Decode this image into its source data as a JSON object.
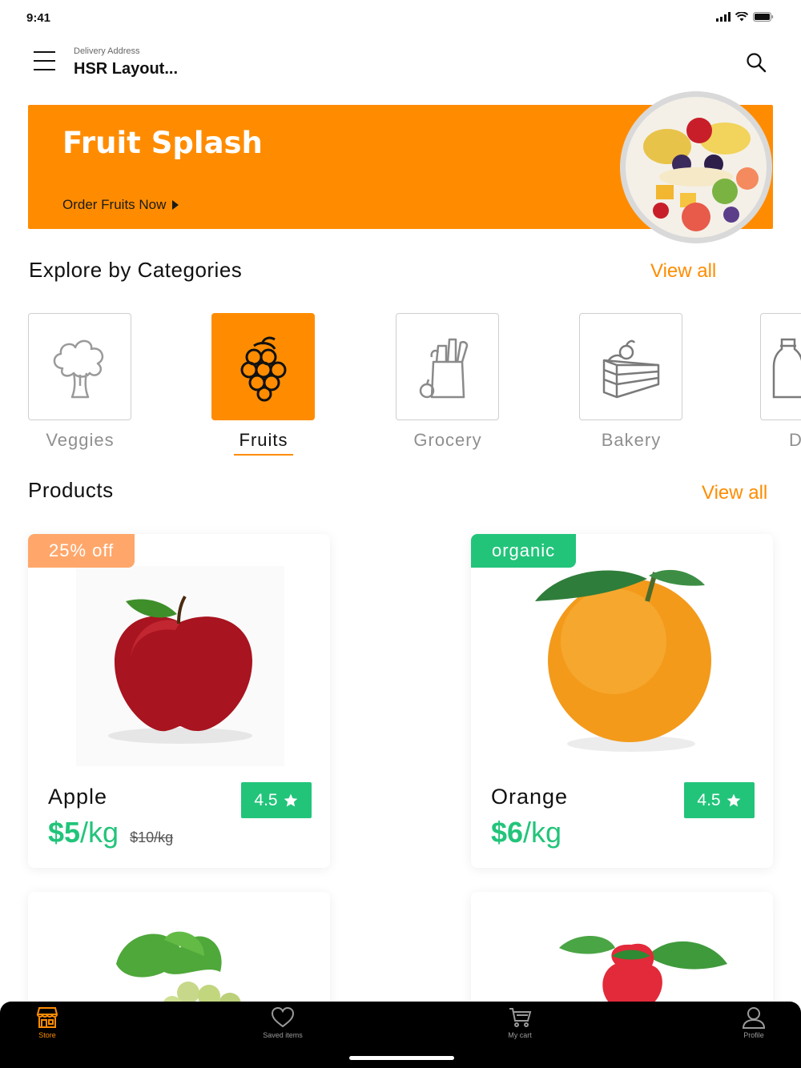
{
  "status_bar": {
    "time": "9:41"
  },
  "header": {
    "address_label": "Delivery Address",
    "address_value": "HSR Layout...",
    "menu_icon": "hamburger-menu-icon",
    "search_icon": "search-icon"
  },
  "banner": {
    "title": "Fruit Splash",
    "cta": "Order Fruits Now",
    "cta_icon": "play-triangle-icon",
    "image": "fruit-bowl-image",
    "color": "#ff8c00"
  },
  "categories": {
    "title": "Explore by Categories",
    "view_all": "View all",
    "items": [
      {
        "label": "Veggies",
        "icon": "broccoli-icon",
        "active": false
      },
      {
        "label": "Fruits",
        "icon": "grapes-icon",
        "active": true
      },
      {
        "label": "Grocery",
        "icon": "grocery-bag-icon",
        "active": false
      },
      {
        "label": "Bakery",
        "icon": "cake-icon",
        "active": false
      },
      {
        "label": "D",
        "icon": "milk-bottle-icon",
        "active": false
      }
    ]
  },
  "products": {
    "title": "Products",
    "view_all": "View all",
    "items": [
      {
        "name": "Apple",
        "price": "$5",
        "unit": "/kg",
        "old_price": "$10/kg",
        "rating": "4.5",
        "badge": "25% off",
        "badge_color": "#ffa76b",
        "image": "red-apple-image"
      },
      {
        "name": "Orange",
        "price": "$6",
        "unit": "/kg",
        "old_price": "",
        "rating": "4.5",
        "badge": "organic",
        "badge_color": "#22c47a",
        "image": "orange-image"
      },
      {
        "image": "green-grapes-image"
      },
      {
        "image": "strawberry-image"
      }
    ]
  },
  "tabbar": {
    "items": [
      {
        "label": "Store",
        "icon": "store-icon",
        "active": true
      },
      {
        "label": "Saved items",
        "icon": "heart-icon",
        "active": false
      },
      {
        "label": "My cart",
        "icon": "cart-icon",
        "active": false
      },
      {
        "label": "Profile",
        "icon": "profile-icon",
        "active": false
      }
    ]
  },
  "colors": {
    "accent": "#ff8c00",
    "success": "#22c47a"
  }
}
